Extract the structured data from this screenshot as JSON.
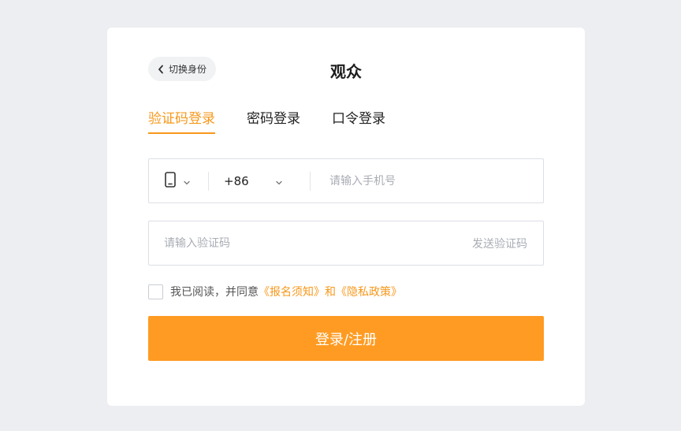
{
  "header": {
    "switch_label": "切换身份",
    "title": "观众"
  },
  "tabs": [
    {
      "label": "验证码登录",
      "active": true
    },
    {
      "label": "密码登录",
      "active": false
    },
    {
      "label": "口令登录",
      "active": false
    }
  ],
  "phone": {
    "country_code": "+86",
    "placeholder": "请输入手机号",
    "value": ""
  },
  "verification": {
    "placeholder": "请输入验证码",
    "value": "",
    "send_label": "发送验证码"
  },
  "agreement": {
    "prefix": "我已阅读，并同意",
    "link1": "《报名须知》",
    "conjunction": "和",
    "link2": "《隐私政策》",
    "checked": false
  },
  "submit_label": "登录/注册",
  "colors": {
    "accent": "#f7981c",
    "button": "#ff9b22",
    "background": "#eceef1"
  },
  "icons": {
    "back": "chevron-left-icon",
    "device": "mobile-phone-icon",
    "dropdown": "chevron-down-icon"
  }
}
